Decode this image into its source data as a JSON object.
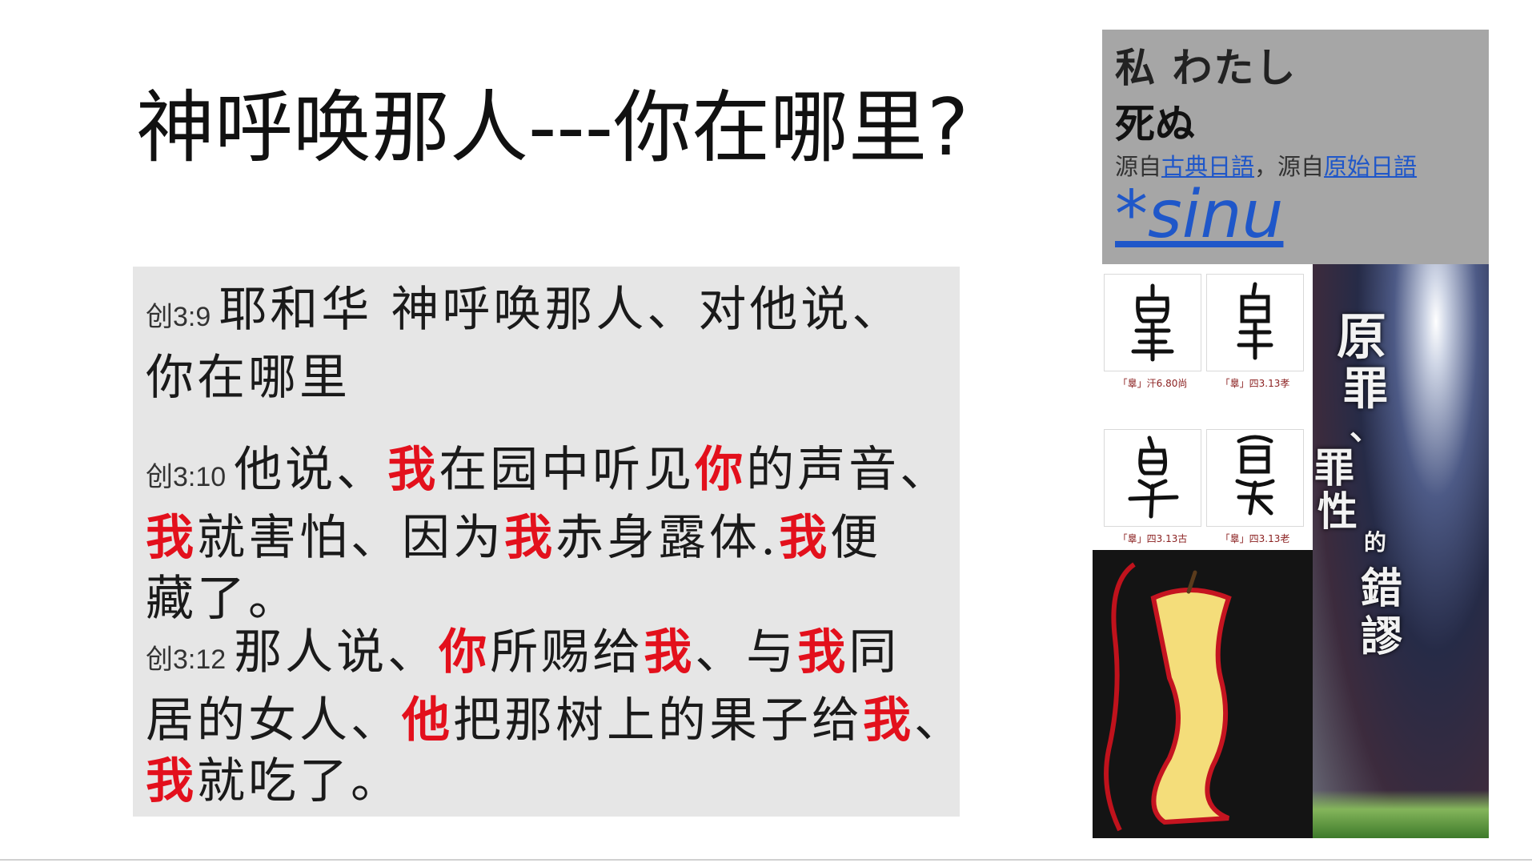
{
  "slide": {
    "title": "神呼唤那人---你在哪里?"
  },
  "verses": {
    "v1": {
      "ref": "创3:9",
      "line1": "耶和华 神呼唤那人、对他说、",
      "line2": "你在哪里"
    },
    "v2": {
      "ref": "创3:10",
      "l1a": "他说、",
      "l1b": "我",
      "l1c": "在园中听见",
      "l1d": "你",
      "l1e": "的声音、",
      "l2a": "我",
      "l2b": "就害怕、因为",
      "l2c": "我",
      "l2d": "赤身露体.",
      "l2e": "我",
      "l2f": "便",
      "l3": "藏了。"
    },
    "v3": {
      "ref": "创3:12",
      "l1a": "那人说、",
      "l1b": "你",
      "l1c": "所赐给",
      "l1d": "我",
      "l1e": "、与",
      "l1f": "我",
      "l1g": "同",
      "l2a": "居的女人、",
      "l2b": "他",
      "l2c": "把那树上的果子给",
      "l2d": "我",
      "l2e": "、",
      "l3a": "我",
      "l3b": "就吃了。"
    }
  },
  "dictionary": {
    "line1": "私 わたし",
    "line2": "死ぬ",
    "prefix1": "源自",
    "link1": "古典日語",
    "sep": "，源自",
    "link2": "原始日語",
    "reconstruction": "*sinu"
  },
  "glyphs": [
    {
      "caption": "「辠」汗6.80尚"
    },
    {
      "caption": "「辠」四3.13孝"
    },
    {
      "caption": "「辠」四3.13古"
    },
    {
      "caption": "「辠」四3.13老"
    }
  ],
  "cover": {
    "c1": "原",
    "c2": "罪",
    "c3": "、",
    "c4": "罪",
    "c5": "性",
    "c6": "的",
    "c7": "錯",
    "c8": "謬"
  },
  "colors": {
    "highlight": "#e3101c",
    "verse_bg": "#e6e6e6",
    "dict_bg": "#a6a6a6",
    "link": "#1f57c9"
  }
}
